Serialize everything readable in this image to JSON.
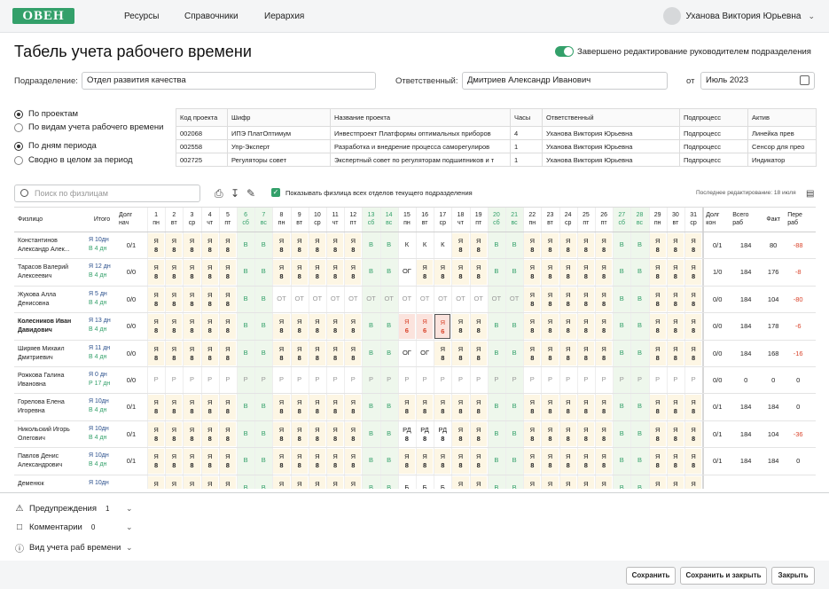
{
  "header": {
    "logo": "ОВЕН",
    "nav": [
      "Ресурсы",
      "Справочники",
      "Иерархия"
    ],
    "user": "Уханова Виктория Юрьевна"
  },
  "page": {
    "title": "Табель учета рабочего времени",
    "finished_label": "Завершено редактирование руководителем подразделения"
  },
  "filters": {
    "subdivision_label": "Подразделение:",
    "subdivision_value": "Отдел развития качества",
    "responsible_label": "Ответственный:",
    "responsible_value": "Дмитриев Александр Иванович",
    "from_label": "от",
    "period_value": "Июль 2023"
  },
  "view_options": [
    {
      "label": "По проектам",
      "selected": true
    },
    {
      "label": "По видам учета рабочего времени",
      "selected": false
    },
    {
      "label": "По дням периода",
      "selected": true
    },
    {
      "label": "Сводно в целом за период",
      "selected": false
    }
  ],
  "projects": {
    "columns": [
      "Код проекта",
      "Шифр",
      "Название проекта",
      "Часы",
      "Ответственный",
      "Подпроцесс",
      "Актив"
    ],
    "rows": [
      [
        "002068",
        "ИПЭ ПлатОптимум",
        "Инвестпроект Платформы оптимальных приборов",
        "4",
        "Уханова Виктория Юрьевна",
        "Подпроцесс",
        "Линейка прев"
      ],
      [
        "002558",
        "Упр-Эксперт",
        "Разработка и внедрение процесса саморегулиров",
        "1",
        "Уханова Виктория Юрьевна",
        "Подпроцесс",
        "Сенсор для прео"
      ],
      [
        "002725",
        "Регуляторы совет",
        "Экспертный совет по регуляторам подшипников и т",
        "1",
        "Уханова Виктория Юрьевна",
        "Подпроцесс",
        "Индикатор"
      ]
    ]
  },
  "toolbar": {
    "search_placeholder": "Поиск по физлицам",
    "show_all_label": "Показывать физлица всех отделов текущего подразделения",
    "last_edit": "Последнее редактирование: 18 июля"
  },
  "timesheet": {
    "headers": {
      "person": "Физлицо",
      "total": "Итого",
      "debt_start": "Долг нач",
      "debt_end": "Долг кон",
      "total_work": "Всего раб",
      "fact": "Факт",
      "over": "Пере раб"
    },
    "days": [
      [
        "1",
        "пн"
      ],
      [
        "2",
        "вт"
      ],
      [
        "3",
        "ср"
      ],
      [
        "4",
        "чт"
      ],
      [
        "5",
        "пт"
      ],
      [
        "6",
        "сб"
      ],
      [
        "7",
        "вс"
      ],
      [
        "8",
        "пн"
      ],
      [
        "9",
        "вт"
      ],
      [
        "10",
        "ср"
      ],
      [
        "11",
        "чт"
      ],
      [
        "12",
        "пт"
      ],
      [
        "13",
        "сб"
      ],
      [
        "14",
        "вс"
      ],
      [
        "15",
        "пн"
      ],
      [
        "16",
        "вт"
      ],
      [
        "17",
        "ср"
      ],
      [
        "18",
        "чт"
      ],
      [
        "19",
        "пт"
      ],
      [
        "20",
        "сб"
      ],
      [
        "21",
        "вс"
      ],
      [
        "22",
        "пн"
      ],
      [
        "23",
        "вт"
      ],
      [
        "24",
        "ср"
      ],
      [
        "25",
        "пт"
      ],
      [
        "26",
        "пт"
      ],
      [
        "27",
        "сб"
      ],
      [
        "28",
        "вс"
      ],
      [
        "29",
        "пн"
      ],
      [
        "30",
        "вт"
      ],
      [
        "31",
        "ср"
      ]
    ],
    "rows": [
      {
        "name": "Константинов Александр Алек...",
        "t1": "Я 10дн",
        "t2": "В 4 дн",
        "ds": "0/1",
        "de": "0/1",
        "tw": "184",
        "fact": "80",
        "over": "-88",
        "cells": "Я8 Я8 Я8 Я8 Я8 В В Я8 Я8 Я8 Я8 Я8 В В К К К Я8 Я8 В В Я8 Я8 Я8 Я8 Я8 В В Я8 Я8 Я8"
      },
      {
        "name": "Тарасов Валерий Алексеевич",
        "t1": "Я 12 дн",
        "t2": "В 4 дн",
        "ds": "0/0",
        "de": "1/0",
        "tw": "184",
        "fact": "176",
        "over": "-8",
        "cells": "Я8 Я8 Я8 Я8 Я8 В В Я8 Я8 Я8 Я8 Я8 В В ОГ Я8 Я8 Я8 Я8 В В Я8 Я8 Я8 Я8 Я8 В В Я8 Я8 Я8"
      },
      {
        "name": "Жукова Алла Денисовна",
        "t1": "Я 5 дн",
        "t2": "В 4 дн",
        "ds": "0/0",
        "de": "0/0",
        "tw": "184",
        "fact": "104",
        "over": "-80",
        "cells": "Я8 Я8 Я8 Я8 Я8 В В ОТ ОТ ОТ ОТ ОТ ОТ ОТ ОТ ОТ ОТ ОТ ОТ ОТ ОТ Я8 Я8 Я8 Я8 Я8 В В Я8 Я8 Я8"
      },
      {
        "name": "Колесников Иван Давидович",
        "t1": "Я 13 дн",
        "t2": "В 4 дн",
        "ds": "0/0",
        "de": "0/0",
        "tw": "184",
        "fact": "178",
        "over": "-6",
        "cells": "Я8 Я8 Я8 Я8 Я8 В В Я8 Я8 Я8 Я8 Я8 В В Я6 Я6 Я6 Я8 Я8 В В Я8 Я8 Я8 Я8 Я8 В В Я8 Я8 Я8"
      },
      {
        "name": "Ширяев Михаил Дмитриевич",
        "t1": "Я 11 дн",
        "t2": "В 4 дн",
        "ds": "0/0",
        "de": "0/0",
        "tw": "184",
        "fact": "168",
        "over": "-16",
        "cells": "Я8 Я8 Я8 Я8 Я8 В В Я8 Я8 Я8 Я8 Я8 В В ОГ ОГ Я8 Я8 Я8 В В Я8 Я8 Я8 Я8 Я8 В В Я8 Я8 Я8"
      },
      {
        "name": "Рожкова Галина Ивановна",
        "t1": "Я 0 дн",
        "t2": "Р 17 дн",
        "ds": "0/0",
        "de": "0/0",
        "tw": "0",
        "fact": "0",
        "over": "0",
        "cells": "Р Р Р Р Р Р Р Р Р Р Р Р Р Р Р Р Р Р Р Р Р Р Р Р Р Р Р Р Р Р Р"
      },
      {
        "name": "Горелова Елена Игоревна",
        "t1": "Я 10дн",
        "t2": "В 4 дн",
        "ds": "0/1",
        "de": "0/1",
        "tw": "184",
        "fact": "184",
        "over": "0",
        "cells": "Я8 Я8 Я8 Я8 Я8 В В Я8 Я8 Я8 Я8 Я8 В В Я8 Я8 Я8 Я8 Я8 В В Я8 Я8 Я8 Я8 Я8 В В Я8 Я8 Я8"
      },
      {
        "name": "Никольский Игорь Олегович",
        "t1": "Я 10дн",
        "t2": "В 4 дн",
        "ds": "0/1",
        "de": "0/1",
        "tw": "184",
        "fact": "104",
        "over": "-36",
        "cells": "Я8 Я8 Я8 Я8 Я8 В В Я8 Я8 Я8 Я8 Я8 В В РД8 РД8 РД8 Я8 Я8 В В Я8 Я8 Я8 Я8 Я8 В В Я8 Я8 Я8"
      },
      {
        "name": "Павлов Денис Александрович",
        "t1": "Я 10дн",
        "t2": "В 4 дн",
        "ds": "0/1",
        "de": "0/1",
        "tw": "184",
        "fact": "184",
        "over": "0",
        "cells": "Я8 Я8 Я8 Я8 Я8 В В Я8 Я8 Я8 Я8 Я8 В В Я8 Я8 Я8 Я8 Я8 В В Я8 Я8 Я8 Я8 Я8 В В Я8 Я8 Я8"
      },
      {
        "name": "Деменюк",
        "t1": "Я 10дн",
        "t2": "",
        "ds": "",
        "de": "",
        "tw": "",
        "fact": "",
        "over": "",
        "cells": "Я8 Я8 Я8 Я8 Я8 В В Я8 Я8 Я8 Я8 Я8 В В Б Б Б Я8 Я8 В В Я8 Я8 Я8 Я8 Я8 В В Я8 Я8 Я8"
      }
    ]
  },
  "sections": [
    {
      "label": "Предупреждения",
      "count": "1"
    },
    {
      "label": "Комментарии",
      "count": "0"
    },
    {
      "label": "Вид учета раб времени",
      "count": ""
    }
  ],
  "buttons": {
    "save": "Сохранить",
    "save_close": "Сохранить и закрыть",
    "close": "Закрыть"
  },
  "colors": {
    "accent": "#33a06a",
    "weekend": "#eef7ec",
    "work": "#fdf6e4",
    "negative": "#d9432b"
  }
}
